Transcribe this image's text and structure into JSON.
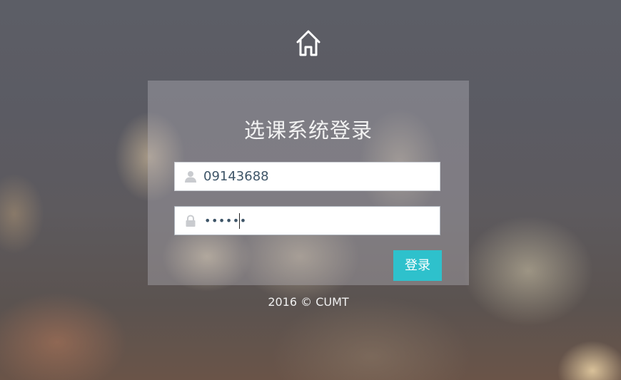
{
  "page": {
    "title": "选课系统登录"
  },
  "home": {
    "icon": "home-icon"
  },
  "login_form": {
    "username": {
      "icon": "user-icon",
      "value": "09143688"
    },
    "password": {
      "icon": "lock-icon",
      "masked_value": "••••••"
    },
    "submit_label": "登录"
  },
  "footer": {
    "text": "2016 © CUMT"
  },
  "colors": {
    "accent": "#2ec1cc",
    "panel": "rgba(185,182,190,0.38)",
    "input_text": "#3e5568"
  }
}
